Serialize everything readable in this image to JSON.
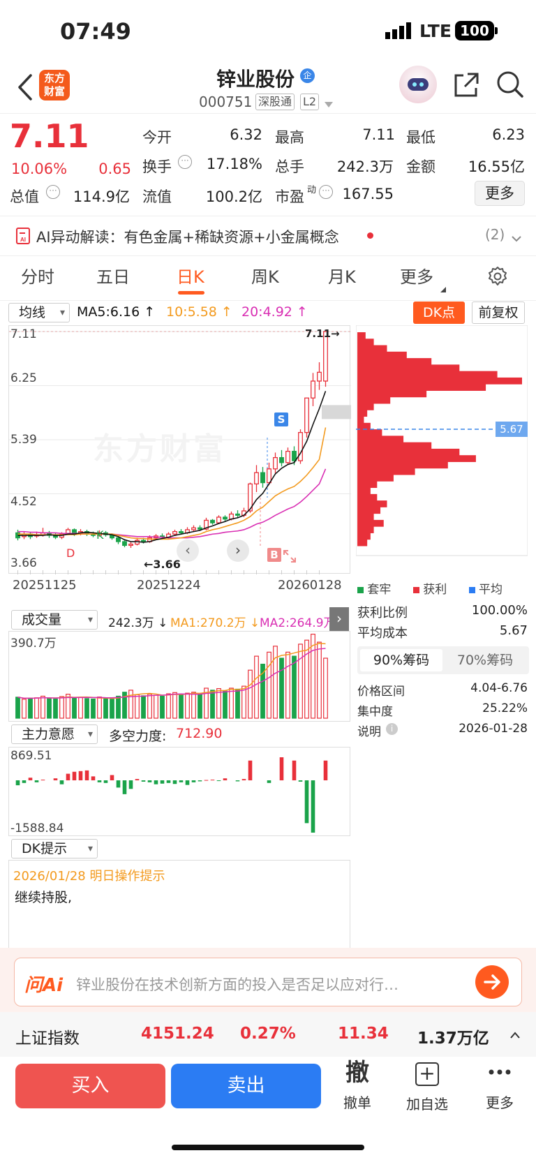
{
  "status": {
    "time": "07:49",
    "network": "LTE",
    "battery": "100"
  },
  "header": {
    "logo": "东方\n财富",
    "stock_name": "锌业股份",
    "badge": "企",
    "code": "000751",
    "tag1": "深股通",
    "tag2": "L2"
  },
  "quote": {
    "price": "7.11",
    "pct": "10.06%",
    "chg": "0.65",
    "labels": {
      "open": "今开",
      "high": "最高",
      "low": "最低",
      "turnover": "换手",
      "volume": "总手",
      "amount": "金额",
      "mcap": "总值",
      "float": "流值",
      "pe": "市盈",
      "pe_sup": "动"
    },
    "open": "6.32",
    "high": "7.11",
    "low": "6.23",
    "turnover": "17.18%",
    "volume": "242.3万",
    "amount": "16.55亿",
    "mcap": "114.9亿",
    "float": "100.2亿",
    "pe": "167.55",
    "more": "更多"
  },
  "ai_banner": {
    "text": "AI异动解读：有色金属+稀缺资源+小金属概念",
    "count": "(2)"
  },
  "tabs": [
    "分时",
    "五日",
    "日K",
    "周K",
    "月K",
    "更多"
  ],
  "active_tab": "日K",
  "kline": {
    "ma_select": "均线",
    "ma5": "MA5:6.16",
    "ma10": "10:5.58",
    "ma20": "20:4.92",
    "dk_btn": "DK点",
    "fq_btn": "前复权",
    "yticks": [
      "7.11",
      "6.25",
      "5.39",
      "4.52",
      "3.66"
    ],
    "xticks": [
      "20251125",
      "20251224",
      "20260128"
    ],
    "high_label": "7.11→",
    "low_label": "←3.66",
    "watermark": "东方财富",
    "markers": {
      "S": "S",
      "B": "B",
      "K": "K",
      "D": "D"
    },
    "cost_label": "5.67"
  },
  "chart_data": {
    "type": "candlestick",
    "ylim": [
      3.66,
      7.11
    ],
    "candles": [
      {
        "o": 3.9,
        "c": 3.82,
        "h": 3.95,
        "l": 3.78
      },
      {
        "o": 3.84,
        "c": 3.88,
        "h": 3.92,
        "l": 3.8
      },
      {
        "o": 3.88,
        "c": 3.84,
        "h": 3.91,
        "l": 3.8
      },
      {
        "o": 3.85,
        "c": 3.87,
        "h": 3.92,
        "l": 3.82
      },
      {
        "o": 3.87,
        "c": 3.9,
        "h": 3.98,
        "l": 3.84
      },
      {
        "o": 3.9,
        "c": 3.86,
        "h": 3.93,
        "l": 3.82
      },
      {
        "o": 3.86,
        "c": 3.83,
        "h": 3.9,
        "l": 3.8
      },
      {
        "o": 3.83,
        "c": 3.88,
        "h": 3.91,
        "l": 3.8
      },
      {
        "o": 3.88,
        "c": 3.95,
        "h": 3.98,
        "l": 3.86
      },
      {
        "o": 3.95,
        "c": 3.88,
        "h": 3.97,
        "l": 3.85
      },
      {
        "o": 3.88,
        "c": 3.92,
        "h": 3.96,
        "l": 3.86
      },
      {
        "o": 3.92,
        "c": 3.88,
        "h": 3.95,
        "l": 3.85
      },
      {
        "o": 3.88,
        "c": 3.86,
        "h": 3.92,
        "l": 3.83
      },
      {
        "o": 3.86,
        "c": 3.9,
        "h": 3.94,
        "l": 3.84
      },
      {
        "o": 3.9,
        "c": 3.87,
        "h": 3.93,
        "l": 3.84
      },
      {
        "o": 3.87,
        "c": 3.82,
        "h": 3.89,
        "l": 3.79
      },
      {
        "o": 3.82,
        "c": 3.76,
        "h": 3.84,
        "l": 3.72
      },
      {
        "o": 3.76,
        "c": 3.7,
        "h": 3.78,
        "l": 3.67
      },
      {
        "o": 3.7,
        "c": 3.72,
        "h": 3.75,
        "l": 3.66
      },
      {
        "o": 3.72,
        "c": 3.78,
        "h": 3.82,
        "l": 3.7
      },
      {
        "o": 3.78,
        "c": 3.76,
        "h": 3.82,
        "l": 3.73
      },
      {
        "o": 3.76,
        "c": 3.82,
        "h": 3.86,
        "l": 3.74
      },
      {
        "o": 3.82,
        "c": 3.85,
        "h": 3.88,
        "l": 3.79
      },
      {
        "o": 3.85,
        "c": 3.83,
        "h": 3.89,
        "l": 3.8
      },
      {
        "o": 3.83,
        "c": 3.88,
        "h": 3.91,
        "l": 3.81
      },
      {
        "o": 3.88,
        "c": 3.92,
        "h": 3.95,
        "l": 3.85
      },
      {
        "o": 3.92,
        "c": 3.9,
        "h": 3.96,
        "l": 3.87
      },
      {
        "o": 3.9,
        "c": 3.95,
        "h": 3.99,
        "l": 3.88
      },
      {
        "o": 3.95,
        "c": 3.98,
        "h": 4.02,
        "l": 3.92
      },
      {
        "o": 3.98,
        "c": 3.96,
        "h": 4.02,
        "l": 3.93
      },
      {
        "o": 3.96,
        "c": 4.1,
        "h": 4.14,
        "l": 3.94
      },
      {
        "o": 4.1,
        "c": 4.06,
        "h": 4.12,
        "l": 4.03
      },
      {
        "o": 4.06,
        "c": 4.15,
        "h": 4.18,
        "l": 4.04
      },
      {
        "o": 4.15,
        "c": 4.12,
        "h": 4.18,
        "l": 4.08
      },
      {
        "o": 4.12,
        "c": 4.2,
        "h": 4.24,
        "l": 4.1
      },
      {
        "o": 4.2,
        "c": 4.18,
        "h": 4.26,
        "l": 4.14
      },
      {
        "o": 4.18,
        "c": 4.25,
        "h": 4.3,
        "l": 4.15
      },
      {
        "o": 4.25,
        "c": 4.68,
        "h": 4.7,
        "l": 4.22
      },
      {
        "o": 4.68,
        "c": 4.86,
        "h": 4.98,
        "l": 4.55
      },
      {
        "o": 4.86,
        "c": 4.7,
        "h": 4.95,
        "l": 4.62
      },
      {
        "o": 4.7,
        "c": 4.92,
        "h": 5.02,
        "l": 4.66
      },
      {
        "o": 4.92,
        "c": 5.1,
        "h": 5.18,
        "l": 4.85
      },
      {
        "o": 5.1,
        "c": 5.02,
        "h": 5.22,
        "l": 4.96
      },
      {
        "o": 5.02,
        "c": 5.2,
        "h": 5.26,
        "l": 4.98
      },
      {
        "o": 5.2,
        "c": 5.05,
        "h": 5.28,
        "l": 4.98
      },
      {
        "o": 5.05,
        "c": 5.5,
        "h": 5.55,
        "l": 5.0
      },
      {
        "o": 5.5,
        "c": 6.05,
        "h": 6.05,
        "l": 5.42
      },
      {
        "o": 6.05,
        "c": 6.32,
        "h": 6.45,
        "l": 5.92
      },
      {
        "o": 6.32,
        "c": 6.46,
        "h": 6.62,
        "l": 6.18
      },
      {
        "o": 6.32,
        "c": 7.11,
        "h": 7.11,
        "l": 6.23
      }
    ],
    "ma5": [
      3.86,
      3.86,
      3.86,
      3.86,
      3.86,
      3.87,
      3.86,
      3.86,
      3.88,
      3.88,
      3.9,
      3.91,
      3.9,
      3.89,
      3.88,
      3.87,
      3.84,
      3.79,
      3.76,
      3.76,
      3.75,
      3.76,
      3.79,
      3.81,
      3.83,
      3.86,
      3.88,
      3.9,
      3.92,
      3.94,
      3.98,
      4.01,
      4.05,
      4.08,
      4.12,
      4.14,
      4.18,
      4.28,
      4.43,
      4.53,
      4.68,
      4.84,
      4.93,
      4.99,
      5.02,
      5.17,
      5.36,
      5.63,
      5.88,
      6.16
    ],
    "ma10": [
      3.88,
      3.88,
      3.88,
      3.87,
      3.87,
      3.87,
      3.87,
      3.87,
      3.87,
      3.87,
      3.88,
      3.88,
      3.88,
      3.88,
      3.88,
      3.88,
      3.86,
      3.84,
      3.82,
      3.81,
      3.81,
      3.8,
      3.8,
      3.8,
      3.8,
      3.81,
      3.82,
      3.84,
      3.86,
      3.88,
      3.92,
      3.95,
      3.97,
      4.0,
      4.03,
      4.06,
      4.1,
      4.16,
      4.25,
      4.31,
      4.4,
      4.49,
      4.55,
      4.6,
      4.64,
      4.72,
      4.82,
      4.94,
      5.07,
      5.58
    ],
    "ma20": [
      3.92,
      3.92,
      3.91,
      3.91,
      3.9,
      3.9,
      3.9,
      3.89,
      3.89,
      3.89,
      3.89,
      3.88,
      3.88,
      3.88,
      3.88,
      3.88,
      3.87,
      3.86,
      3.85,
      3.84,
      3.84,
      3.84,
      3.83,
      3.83,
      3.82,
      3.82,
      3.82,
      3.82,
      3.83,
      3.84,
      3.86,
      3.88,
      3.89,
      3.91,
      3.92,
      3.93,
      3.95,
      3.99,
      4.04,
      4.07,
      4.12,
      4.18,
      4.23,
      4.28,
      4.32,
      4.39,
      4.48,
      4.58,
      4.68,
      4.92
    ],
    "volume": [
      105,
      95,
      100,
      102,
      110,
      98,
      96,
      108,
      120,
      100,
      104,
      98,
      96,
      106,
      99,
      95,
      110,
      130,
      140,
      118,
      112,
      120,
      115,
      110,
      122,
      128,
      118,
      125,
      130,
      120,
      150,
      140,
      148,
      135,
      150,
      145,
      160,
      240,
      310,
      270,
      330,
      360,
      300,
      330,
      310,
      370,
      390,
      420,
      380,
      300
    ],
    "volume_max": 390.7,
    "power": [
      -150,
      -80,
      80,
      -60,
      20,
      0,
      60,
      -120,
      200,
      260,
      280,
      300,
      120,
      -60,
      -80,
      160,
      -220,
      -420,
      -260,
      40,
      -40,
      -60,
      -120,
      -100,
      -80,
      -110,
      -60,
      -140,
      -60,
      -30,
      10,
      20,
      -20,
      60,
      0,
      -30,
      40,
      600,
      0,
      0,
      -80,
      0,
      700,
      0,
      600,
      -40,
      -1300,
      -1588,
      0,
      600
    ],
    "power_range": [
      -1588.84,
      869.51
    ],
    "chip_profile": [
      0.05,
      0.1,
      0.18,
      0.3,
      0.45,
      0.62,
      0.85,
      1.0,
      0.78,
      0.42,
      0.2,
      0.1,
      0.06,
      0.04,
      0.08,
      0.15,
      0.28,
      0.45,
      0.62,
      0.72,
      0.55,
      0.35,
      0.22,
      0.12,
      0.08,
      0.12,
      0.18,
      0.14,
      0.1,
      0.16,
      0.1,
      0.08,
      0.06
    ],
    "chip_avg": 5.67
  },
  "volume_panel": {
    "select": "成交量",
    "value": "242.3万",
    "ma1": "MA1:270.2万",
    "ma2": "MA2:264.9万",
    "ymax": "390.7万"
  },
  "power_panel": {
    "select": "主力意愿",
    "label": "多空力度:",
    "value": "712.90",
    "ymax": "869.51",
    "ymin": "-1588.84"
  },
  "dk_panel": {
    "select": "DK提示",
    "date_line": "2026/01/28 明日操作提示",
    "advice": "继续持股,"
  },
  "chips": {
    "legend": [
      "套牢",
      "获利",
      "平均"
    ],
    "rows": [
      {
        "k": "获利比例",
        "v": "100.00%"
      },
      {
        "k": "平均成本",
        "v": "5.67"
      }
    ],
    "tabs": [
      "90%筹码",
      "70%筹码"
    ],
    "rows2": [
      {
        "k": "价格区间",
        "v": "4.04-6.76"
      },
      {
        "k": "集中度",
        "v": "25.22%"
      },
      {
        "k": "说明",
        "v": "2026-01-28"
      }
    ]
  },
  "ask_ai": {
    "logo": "问Ai",
    "placeholder": "锌业股份在技术创新方面的投入是否足以应对行…"
  },
  "index_bar": {
    "name": "上证指数",
    "price": "4151.24",
    "pct": "0.27%",
    "chg": "11.34",
    "amount": "1.37万亿"
  },
  "bottom": {
    "buy": "买入",
    "sell": "卖出",
    "cancel_icon": "撤",
    "cancel": "撤单",
    "add_icon": "+",
    "add": "加自选",
    "more": "更多"
  },
  "colors": {
    "up": "#e8303a",
    "down": "#1aa34a",
    "accent": "#ff5a1f",
    "ma5": "#111111",
    "ma10": "#f39a1e",
    "ma20": "#d92fb3",
    "sell_btn": "#2b7cf3"
  }
}
